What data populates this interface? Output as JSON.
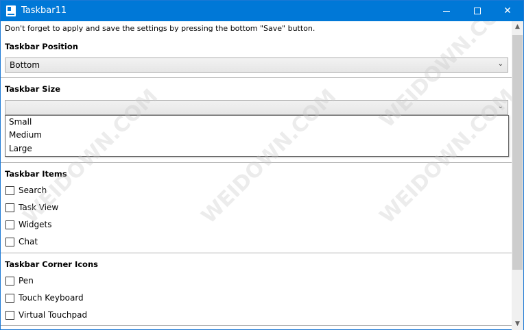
{
  "window": {
    "title": "Taskbar11"
  },
  "hint": "Don't forget to apply and save the settings by pressing the bottom \"Save\" button.",
  "position": {
    "heading": "Taskbar Position",
    "selected": "Bottom"
  },
  "size": {
    "heading": "Taskbar Size",
    "selected": "",
    "options": [
      "Small",
      "Medium",
      "Large"
    ]
  },
  "items": {
    "heading": "Taskbar Items",
    "checks": [
      {
        "label": "Search",
        "checked": false
      },
      {
        "label": "Task View",
        "checked": false
      },
      {
        "label": "Widgets",
        "checked": false
      },
      {
        "label": "Chat",
        "checked": false
      }
    ]
  },
  "corner": {
    "heading": "Taskbar Corner Icons",
    "checks": [
      {
        "label": "Pen",
        "checked": false
      },
      {
        "label": "Touch Keyboard",
        "checked": false
      },
      {
        "label": "Virtual Touchpad",
        "checked": false
      }
    ]
  },
  "watermark": "WEIDOWN.COM",
  "colors": {
    "titlebar": "#0078d7",
    "border": "#1b78d4"
  }
}
